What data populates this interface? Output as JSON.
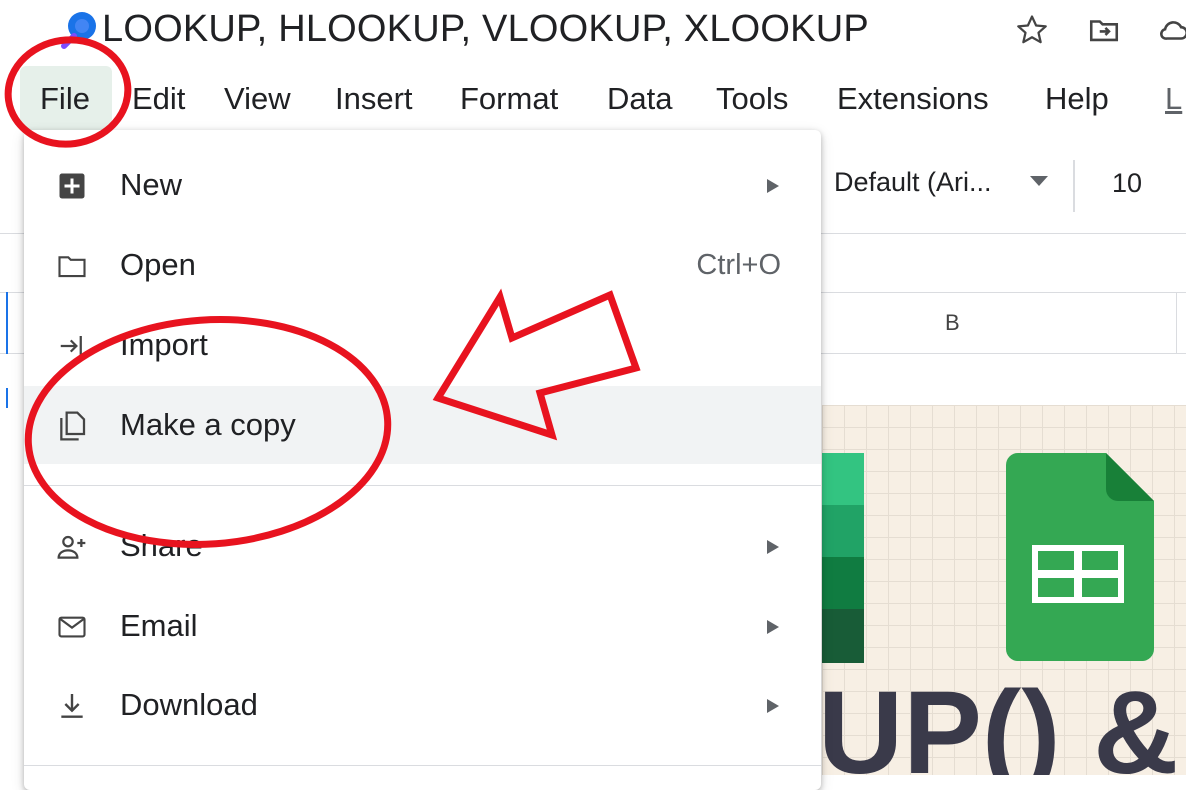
{
  "doc": {
    "title": "LOOKUP, HLOOKUP, VLOOKUP, XLOOKUP",
    "icons": [
      "star-icon",
      "move-to-folder-icon",
      "cloud-status-icon"
    ]
  },
  "menubar": {
    "items": [
      {
        "label": "File"
      },
      {
        "label": "Edit"
      },
      {
        "label": "View"
      },
      {
        "label": "Insert"
      },
      {
        "label": "Format"
      },
      {
        "label": "Data"
      },
      {
        "label": "Tools"
      },
      {
        "label": "Extensions"
      },
      {
        "label": "Help"
      },
      {
        "label": "L"
      }
    ],
    "active": "File"
  },
  "toolbar": {
    "font": "Default (Ari...",
    "font_size": "10"
  },
  "grid": {
    "column_b": "B"
  },
  "file_menu": {
    "items": [
      {
        "label": "New",
        "icon": "new-plus-icon",
        "submenu": true
      },
      {
        "label": "Open",
        "icon": "folder-icon",
        "shortcut": "Ctrl+O"
      },
      {
        "label": "Import",
        "icon": "import-icon"
      },
      {
        "label": "Make a copy",
        "icon": "copy-icon",
        "highlighted": true
      },
      {
        "label": "Share",
        "icon": "person-add-icon",
        "submenu": true
      },
      {
        "label": "Email",
        "icon": "mail-icon",
        "submenu": true
      },
      {
        "label": "Download",
        "icon": "download-icon",
        "submenu": true
      }
    ]
  },
  "thumbnail": {
    "text": "UP() & I"
  },
  "annotations": {
    "color": "#e8131f"
  },
  "colors": {
    "menu_active_bg": "#e6f0ea",
    "menu_highlight": "#f1f3f4",
    "sheets_green": "#34a853",
    "excel_green": "#1e7145"
  }
}
